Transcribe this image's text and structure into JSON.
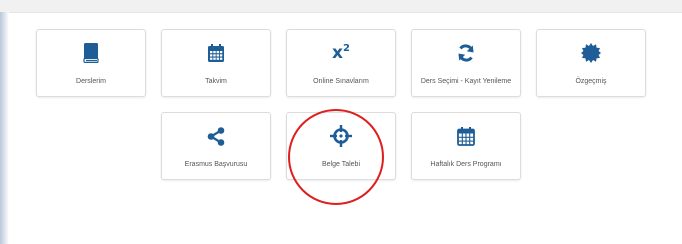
{
  "accent_color": "#1f5d96",
  "highlight_color": "#e01e1e",
  "tiles": [
    {
      "label": "Derslerim",
      "icon": "book-icon"
    },
    {
      "label": "Takvim",
      "icon": "calendar-icon"
    },
    {
      "label": "Online Sınavlarım",
      "icon": "superscript-x2-icon",
      "icon_text": "x",
      "icon_sup": "2"
    },
    {
      "label": "Ders Seçimi - Kayıt Yenileme",
      "icon": "refresh-icon"
    },
    {
      "label": "Özgeçmiş",
      "icon": "certificate-icon"
    },
    {
      "label": "Erasmus Başvurusu",
      "icon": "share-icon"
    },
    {
      "label": "Belge Talebi",
      "icon": "crosshair-icon"
    },
    {
      "label": "Haftalık Ders Programı",
      "icon": "calendar-grid-icon"
    }
  ]
}
